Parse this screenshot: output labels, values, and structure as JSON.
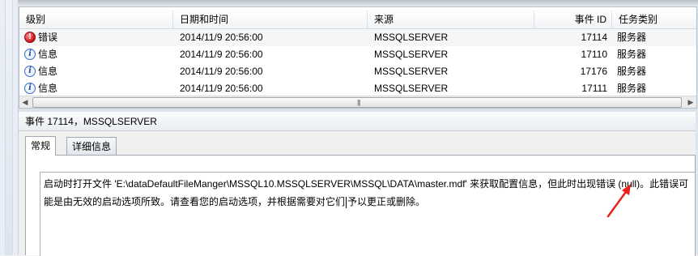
{
  "columns": {
    "level": "级别",
    "datetime": "日期和时间",
    "source": "来源",
    "event_id": "事件 ID",
    "task_category": "任务类别"
  },
  "events": [
    {
      "level": "错误",
      "level_icon": "error-icon",
      "datetime": "2014/11/9 20:56:00",
      "source": "MSSQLSERVER",
      "event_id": "17114",
      "task_category": "服务器"
    },
    {
      "level": "信息",
      "level_icon": "info-icon",
      "datetime": "2014/11/9 20:56:00",
      "source": "MSSQLSERVER",
      "event_id": "17110",
      "task_category": "服务器"
    },
    {
      "level": "信息",
      "level_icon": "info-icon",
      "datetime": "2014/11/9 20:56:00",
      "source": "MSSQLSERVER",
      "event_id": "17176",
      "task_category": "服务器"
    },
    {
      "level": "信息",
      "level_icon": "info-icon",
      "datetime": "2014/11/9 20:56:00",
      "source": "MSSQLSERVER",
      "event_id": "17111",
      "task_category": "服务器"
    }
  ],
  "detail": {
    "title": "事件 17114，MSSQLSERVER",
    "tabs": [
      "常规",
      "详细信息"
    ],
    "active_tab": "常规",
    "message_part1": "启动时打开文件 'E:\\dataDefaultFileManger\\MSSQL10.MSSQLSERVER\\MSSQL\\DATA\\master.mdf' 来获取配置信息，但此时出现错误 (null)。此错误可能是由无效的启动选项所致。请查看您的启动选项，并根据需要对它们",
    "message_part2": "予以更正或删除。"
  },
  "colors": {
    "annotation_arrow": "#e8231c",
    "error_icon": "#c0141a",
    "info_icon": "#3b6ec4"
  }
}
